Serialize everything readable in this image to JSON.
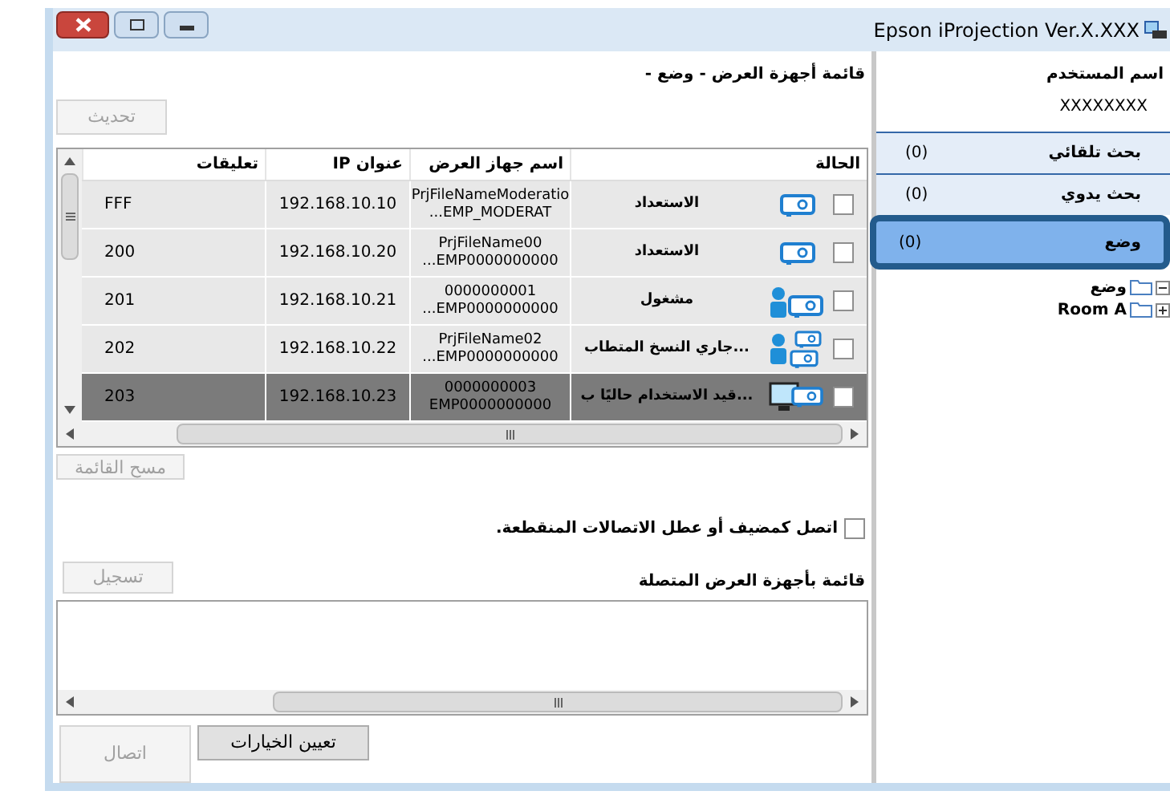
{
  "window": {
    "title": "Epson iProjection Ver.X.XXX"
  },
  "list_header": "قائمة أجهزة العرض - وضع -",
  "refresh_button": {
    "label": "تحديث",
    "disabled": true
  },
  "table": {
    "columns": [
      "الحالة",
      "اسم جهاز العرض",
      "عنوان IP",
      "تعليقات"
    ],
    "rows": [
      {
        "checked": false,
        "kind": "projector",
        "status": "الاستعداد",
        "name": [
          "PrjFileNameModeratio",
          "...EMP_MODERAT"
        ],
        "ip": "192.168.10.10",
        "comment": "FFF",
        "selected": false
      },
      {
        "checked": false,
        "kind": "projector",
        "status": "الاستعداد",
        "name": [
          "PrjFileName00",
          "...EMP0000000000"
        ],
        "ip": "192.168.10.20",
        "comment": "200",
        "selected": false
      },
      {
        "checked": false,
        "kind": "user_projector",
        "status": "مشغول",
        "name": [
          "0000000001",
          "...EMP0000000000"
        ],
        "ip": "192.168.10.21",
        "comment": "201",
        "selected": false
      },
      {
        "checked": false,
        "kind": "user_projectors",
        "status": "...جاري النسخ المتطاب",
        "name": [
          "PrjFileName02",
          "...EMP0000000000"
        ],
        "ip": "192.168.10.22",
        "comment": "202",
        "selected": false
      },
      {
        "checked": false,
        "kind": "monitor_projector",
        "status": "...قيد الاستخدام حاليًا ب",
        "name": [
          "0000000003",
          "EMP0000000000"
        ],
        "ip": "192.168.10.23",
        "comment": "203",
        "selected": true
      }
    ]
  },
  "clear_button": {
    "label": "مسح القائمة",
    "disabled": true
  },
  "host_checkbox": {
    "label": "اتصل كمضيف أو عطل الاتصالات المنقطعة.",
    "checked": false
  },
  "connected_header": "قائمة بأجهزة العرض المتصلة",
  "register_button": {
    "label": "تسجيل",
    "disabled": true
  },
  "set_options_button": {
    "label": "تعيين الخيارات",
    "disabled": false
  },
  "connect_button": {
    "label": "اتصال",
    "disabled": true
  },
  "user": {
    "label": "اسم المستخدم",
    "value": "XXXXXXXX"
  },
  "search_tabs": [
    {
      "label": "بحث تلقائي",
      "count": "(0)",
      "selected": false
    },
    {
      "label": "بحث يدوي",
      "count": "(0)",
      "selected": false
    },
    {
      "label": "وضع",
      "count": "(0)",
      "selected": true
    }
  ],
  "tree": [
    {
      "label": "وضع",
      "expanded": true
    },
    {
      "label": "Room A",
      "expanded": false
    }
  ]
}
